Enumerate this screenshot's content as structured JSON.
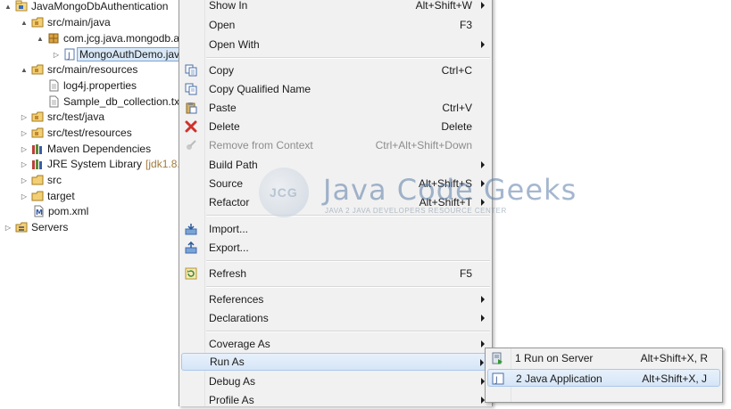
{
  "tree": {
    "items": [
      {
        "label": "JavaMongoDbAuthentication",
        "icon": "project-icon",
        "twisty": "▲"
      },
      {
        "label": "src/main/java",
        "icon": "source-folder-icon",
        "twisty": "▲"
      },
      {
        "label": "com.jcg.java.mongodb.a",
        "icon": "package-icon",
        "twisty": "▲"
      },
      {
        "label": "MongoAuthDemo.jav",
        "icon": "java-file-icon",
        "twisty": "▷"
      },
      {
        "label": "src/main/resources",
        "icon": "source-folder-icon",
        "twisty": "▲"
      },
      {
        "label": "log4j.properties",
        "icon": "file-icon",
        "twisty": ""
      },
      {
        "label": "Sample_db_collection.txt",
        "icon": "file-icon",
        "twisty": ""
      },
      {
        "label": "src/test/java",
        "icon": "source-folder-icon",
        "twisty": "▷"
      },
      {
        "label": "src/test/resources",
        "icon": "source-folder-icon",
        "twisty": "▷"
      },
      {
        "label": "Maven Dependencies",
        "icon": "library-icon",
        "twisty": "▷"
      },
      {
        "label": "JRE System Library",
        "extra": "[jdk1.8.0_",
        "icon": "library-icon",
        "twisty": "▷"
      },
      {
        "label": "src",
        "icon": "folder-icon",
        "twisty": "▷"
      },
      {
        "label": "target",
        "icon": "folder-icon",
        "twisty": "▷"
      },
      {
        "label": "pom.xml",
        "icon": "maven-file-icon",
        "twisty": ""
      },
      {
        "label": "Servers",
        "icon": "servers-folder-icon",
        "twisty": "▷"
      }
    ]
  },
  "menu": {
    "items": [
      {
        "label": "Show In",
        "key": "Alt+Shift+W",
        "arrow": true
      },
      {
        "label": "Open",
        "key": "F3"
      },
      {
        "label": "Open With",
        "key": "",
        "arrow": true
      },
      {
        "label": "Copy",
        "key": "Ctrl+C",
        "icon": "copy-icon"
      },
      {
        "label": "Copy Qualified Name",
        "key": "",
        "icon": "copy-qualified-icon"
      },
      {
        "label": "Paste",
        "key": "Ctrl+V",
        "icon": "paste-icon"
      },
      {
        "label": "Delete",
        "key": "Delete",
        "icon": "delete-icon"
      },
      {
        "label": "Remove from Context",
        "key": "Ctrl+Alt+Shift+Down",
        "icon": "remove-context-icon",
        "disabled": true
      },
      {
        "label": "Build Path",
        "key": "",
        "arrow": true
      },
      {
        "label": "Source",
        "key": "Alt+Shift+S",
        "arrow": true
      },
      {
        "label": "Refactor",
        "key": "Alt+Shift+T",
        "arrow": true
      },
      {
        "label": "Import...",
        "key": "",
        "icon": "import-icon"
      },
      {
        "label": "Export...",
        "key": "",
        "icon": "export-icon"
      },
      {
        "label": "Refresh",
        "key": "F5",
        "icon": "refresh-icon"
      },
      {
        "label": "References",
        "key": "",
        "arrow": true
      },
      {
        "label": "Declarations",
        "key": "",
        "arrow": true
      },
      {
        "label": "Coverage As",
        "key": "",
        "arrow": true
      },
      {
        "label": "Run As",
        "key": "",
        "arrow": true,
        "hover": true
      },
      {
        "label": "Debug As",
        "key": "",
        "arrow": true
      },
      {
        "label": "Profile As",
        "key": "",
        "arrow": true
      }
    ]
  },
  "submenu": {
    "items": [
      {
        "label": "1 Run on Server",
        "key": "Alt+Shift+X, R",
        "icon": "run-on-server-icon"
      },
      {
        "label": "2 Java Application",
        "key": "Alt+Shift+X, J",
        "icon": "java-app-icon",
        "hover": true
      }
    ]
  },
  "watermark": {
    "logo": "JCG",
    "title": "Java Code Geeks",
    "subtitle": "JAVA 2 JAVA DEVELOPERS RESOURCE CENTER"
  }
}
